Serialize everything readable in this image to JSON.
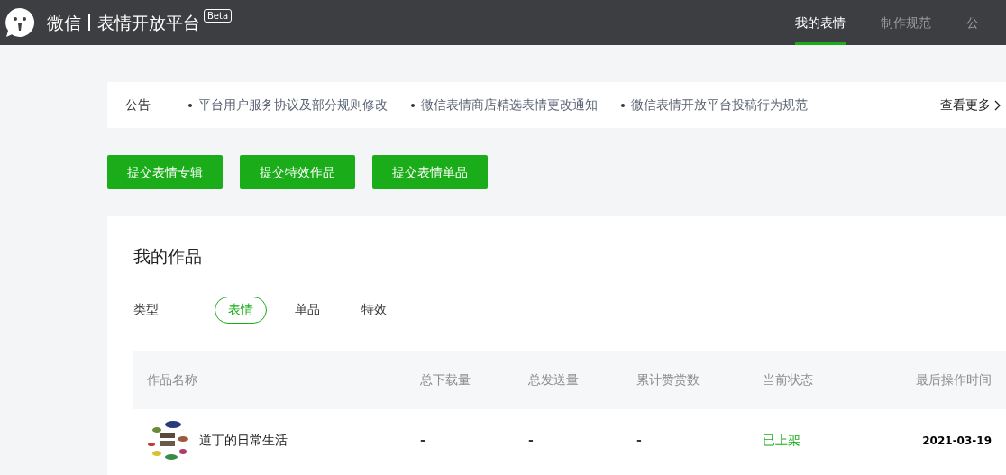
{
  "header": {
    "brand": "微信",
    "product": "表情开放平台",
    "badge": "Beta",
    "nav": [
      {
        "label": "我的表情",
        "selected": true
      },
      {
        "label": "制作规范",
        "selected": false
      },
      {
        "label": "公",
        "selected": false
      }
    ]
  },
  "notice": {
    "label": "公告",
    "items": [
      "平台用户服务协议及部分规则修改",
      "微信表情商店精选表情更改通知",
      "微信表情开放平台投稿行为规范"
    ],
    "more": "查看更多"
  },
  "actions": [
    "提交表情专辑",
    "提交特效作品",
    "提交表情单品"
  ],
  "works": {
    "title": "我的作品",
    "filter_label": "类型",
    "filters": [
      {
        "label": "表情",
        "selected": true
      },
      {
        "label": "单品",
        "selected": false
      },
      {
        "label": "特效",
        "selected": false
      }
    ],
    "table": {
      "columns": [
        "作品名称",
        "总下载量",
        "总发送量",
        "累计赞赏数",
        "当前状态",
        "最后操作时间"
      ],
      "rows": [
        {
          "name": "道丁的日常生活",
          "downloads": "-",
          "sends": "-",
          "rewards": "-",
          "status": "已上架",
          "updated": "2021-03-19"
        }
      ]
    }
  }
}
